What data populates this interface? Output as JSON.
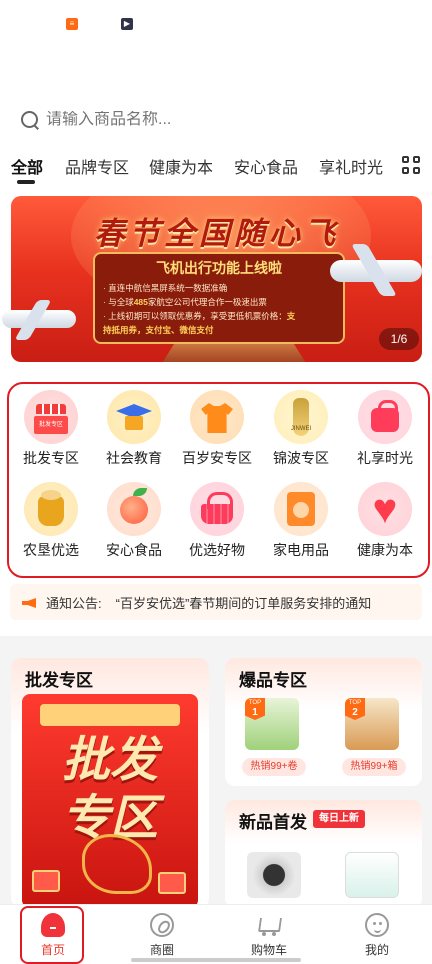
{
  "search": {
    "placeholder": "请输入商品名称..."
  },
  "tabs": [
    {
      "label": "全部"
    },
    {
      "label": "品牌专区"
    },
    {
      "label": "健康为本"
    },
    {
      "label": "安心食品"
    },
    {
      "label": "享礼时光"
    }
  ],
  "banner": {
    "title": "春节全国随心飞",
    "box_title": "飞机出行功能上线啦",
    "line1": "· 直连中航信黑屏系统一数据准确",
    "line2_pre": "· 与全球",
    "line2_num": "485",
    "line2_post": "家航空公司代理合作一极速出票",
    "line3_pre": "· 上线初期可以领取优惠券，享受更低机票价格：",
    "line3_highlight": "支",
    "line4_highlight": "持抵用券，支付宝、微信支付",
    "counter": "1/6"
  },
  "categories": [
    {
      "label": "批发专区",
      "icon": "wholesale-store-icon"
    },
    {
      "label": "社会教育",
      "icon": "graduation-cap-icon"
    },
    {
      "label": "百岁安专区",
      "icon": "tshirt-icon"
    },
    {
      "label": "锦波专区",
      "icon": "bottle-icon"
    },
    {
      "label": "礼享时光",
      "icon": "shopping-bag-icon"
    },
    {
      "label": "农垦优选",
      "icon": "rice-sack-icon"
    },
    {
      "label": "安心食品",
      "icon": "peach-icon"
    },
    {
      "label": "优选好物",
      "icon": "basket-icon"
    },
    {
      "label": "家电用品",
      "icon": "washing-machine-icon"
    },
    {
      "label": "健康为本",
      "icon": "heartbeat-icon"
    }
  ],
  "notice": {
    "label": "通知公告:",
    "text": "“百岁安优选”春节期间的订单服务安排的通知"
  },
  "cards": {
    "wholesale": {
      "title": "批发专区",
      "image_line1": "批发",
      "image_line2": "专区"
    },
    "hot": {
      "title": "爆品专区",
      "items": [
        {
          "rank_label": "TOP",
          "rank": "1",
          "tag": "热销99+卷"
        },
        {
          "rank_label": "TOP",
          "rank": "2",
          "tag": "热销99+箱"
        }
      ]
    },
    "new": {
      "title": "新品首发",
      "badge": "每日上新"
    }
  },
  "bottom_nav": [
    {
      "label": "首页",
      "icon": "home-icon"
    },
    {
      "label": "商圈",
      "icon": "compass-icon"
    },
    {
      "label": "购物车",
      "icon": "cart-icon"
    },
    {
      "label": "我的",
      "icon": "profile-icon"
    }
  ],
  "colors": {
    "accent": "#e83a2e",
    "highlight_border": "#e01b24"
  }
}
